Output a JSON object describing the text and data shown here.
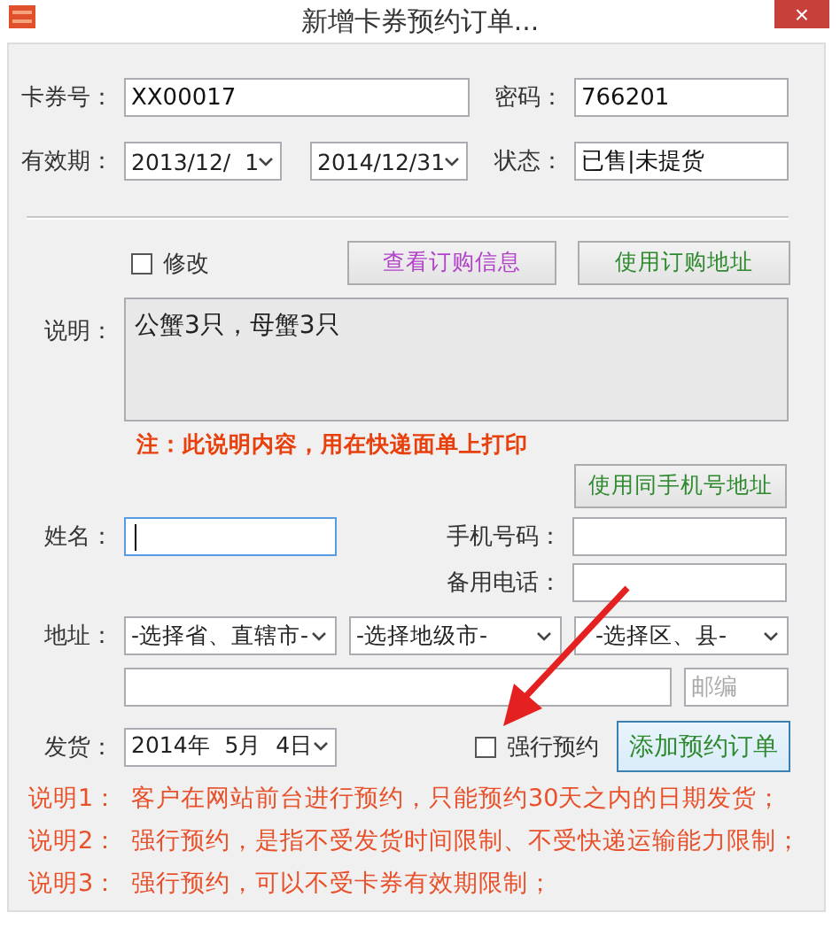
{
  "window": {
    "title": "新增卡券预约订单...",
    "close": "×"
  },
  "card_no": {
    "label": "卡券号：",
    "value": "XX00017"
  },
  "password": {
    "label": "密码：",
    "value": "766201"
  },
  "validity": {
    "label": "有效期：",
    "start": "2013/12/  1",
    "end": "2014/12/31"
  },
  "status": {
    "label": "状态：",
    "value": "已售|未提货"
  },
  "modify": {
    "label": "修改",
    "checked": false
  },
  "view_order_button": "查看订购信息",
  "use_order_address_button": "使用订购地址",
  "description": {
    "label": "说明：",
    "value": "公蟹3只，母蟹3只"
  },
  "note": "注：此说明内容，用在快递面单上打印",
  "same_phone_button": "使用同手机号地址",
  "name": {
    "label": "姓名：",
    "focused": true
  },
  "mobile": {
    "label": "手机号码："
  },
  "backup_phone": {
    "label": "备用电话："
  },
  "address": {
    "label": "地址：",
    "province": "-选择省、直辖市-",
    "city": "-选择地级市-",
    "district": "-选择区、县-"
  },
  "postcode": {
    "placeholder": "邮编"
  },
  "ship": {
    "label": "发货：",
    "value": "2014年  5月  4日"
  },
  "force": {
    "label": "强行预约",
    "checked": false
  },
  "add_button": "添加预约订单",
  "notes": [
    {
      "label": "说明1：",
      "text": "客户在网站前台进行预约，只能预约30天之内的日期发货；"
    },
    {
      "label": "说明2：",
      "text": "强行预约，是指不受发货时间限制、不受快递运输能力限制；"
    },
    {
      "label": "说明3：",
      "text": "强行预约，可以不受卡券有效期限制；"
    }
  ]
}
